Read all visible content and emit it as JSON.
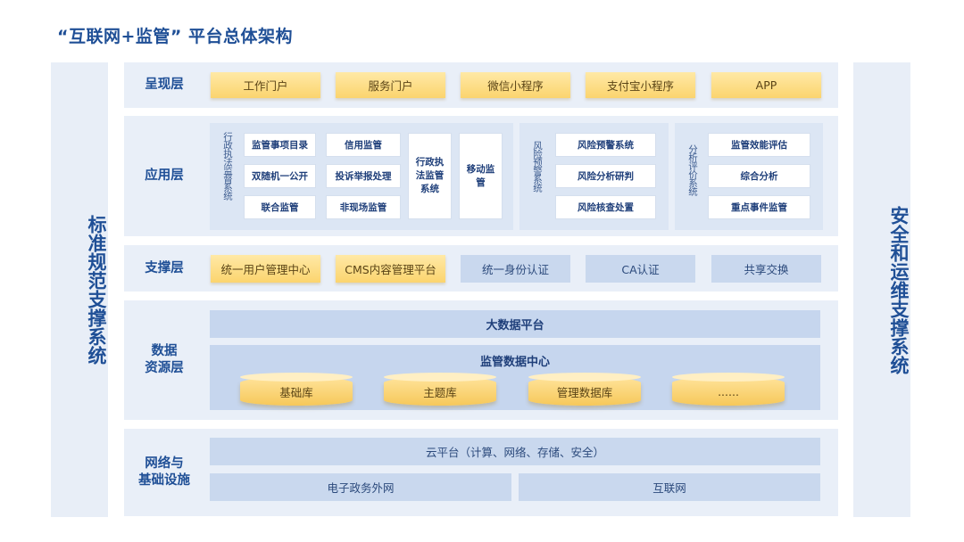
{
  "title": "“互联网+监管” 平台总体架构",
  "left_side": "标准规范支撑系统",
  "right_side": "安全和运维支撑系统",
  "layers": {
    "presentation": {
      "label": "呈现层",
      "items": [
        "工作门户",
        "服务门户",
        "微信小程序",
        "支付宝小程序",
        "APP"
      ]
    },
    "application": {
      "label": "应用层",
      "group1_title": "行政执法监督系统",
      "group1_items": [
        "监管事项目录",
        "信用监管",
        "双随机一公开",
        "投诉举报处理",
        "联合监管",
        "非现场监管"
      ],
      "tall_items": [
        "行政执法监管系统",
        "移动监管"
      ],
      "group2_title": "风险预警系统",
      "group2_items": [
        "风险预警系统",
        "风险分析研判",
        "风险核查处置"
      ],
      "group3_title": "分析评价系统",
      "group3_items": [
        "监管效能评估",
        "综合分析",
        "重点事件监管"
      ]
    },
    "support": {
      "label": "支撑层",
      "items": [
        "统一用户管理中心",
        "CMS内容管理平台",
        "统一身份认证",
        "CA认证",
        "共享交换"
      ]
    },
    "data": {
      "label_line1": "数据",
      "label_line2": "资源层",
      "bigdata": "大数据平台",
      "center": "监管数据中心",
      "dbs": [
        "基础库",
        "主题库",
        "管理数据库",
        "......"
      ]
    },
    "infra": {
      "label_line1": "网络与",
      "label_line2": "基础设施",
      "cloud": "云平台（计算、网络、存储、安全）",
      "nets": [
        "电子政务外网",
        "互联网"
      ]
    }
  }
}
